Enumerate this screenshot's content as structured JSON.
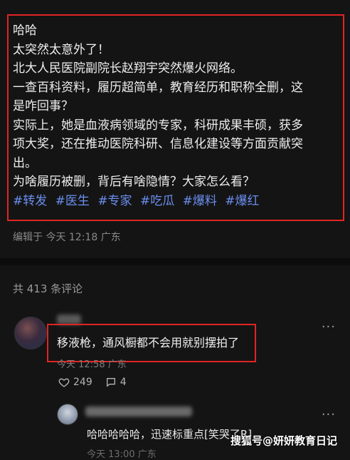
{
  "post": {
    "lines": [
      "哈哈",
      "太突然太意外了！",
      "北大人民医院副院长赵翔宇突然爆火网络。",
      "一查百科资料，履历超简单，教育经历和职称全删，这",
      "是咋回事？",
      "实际上，她是血液病领域的专家，科研成果丰硕，获多",
      "项大奖，还在推动医院科研、信息化建设等方面贡献突",
      "出。",
      "为啥履历被删，背后有啥隐情？大家怎么看？"
    ],
    "tags": [
      "#转发",
      "#医生",
      "#专家",
      "#吃瓜",
      "#爆料",
      "#爆红"
    ]
  },
  "meta": {
    "edited": "编辑于 今天 12:18 广东"
  },
  "comments_header": "共 413 条评论",
  "comment": {
    "text": "移液枪，通风橱都不会用就别摆拍了",
    "time": "今天 12:58 广东",
    "likes": "249",
    "replies": "4"
  },
  "reply": {
    "text": "哈哈哈哈哈，迅速标重点[笑哭了R]",
    "time": "今天 13:00 广东"
  },
  "watermark": "搜狐号@妍妍教育日记",
  "colors": {
    "highlight_border": "#e02424",
    "tag": "#6b8ff0",
    "background": "#141414"
  }
}
